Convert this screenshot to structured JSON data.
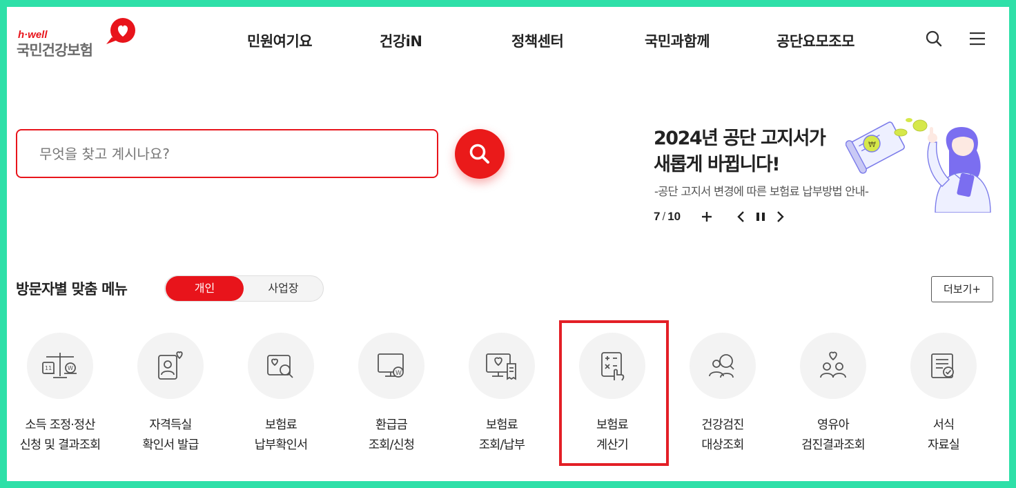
{
  "header": {
    "logo_small": "h·well",
    "logo_name": "국민건강보험",
    "nav": [
      {
        "label": "민원여기요"
      },
      {
        "label": "건강iN"
      },
      {
        "label": "정책센터"
      },
      {
        "label": "국민과함께"
      },
      {
        "label": "공단요모조모"
      }
    ],
    "icons": [
      "search-icon",
      "menu-icon"
    ]
  },
  "search": {
    "placeholder": "무엇을 찾고 계시나요?",
    "value": ""
  },
  "banner": {
    "title_line1": "2024년 공단 고지서가",
    "title_line2": "새롭게 바뀝니다!",
    "subtitle": "-공단 고지서 변경에 따른 보험료 납부방법 안내-",
    "current": "7",
    "separator": "/",
    "total": "10"
  },
  "visitor_menu": {
    "title": "방문자별 맞춤 메뉴",
    "toggle": {
      "active": "개인",
      "inactive": "사업장"
    },
    "more_label": "더보기+",
    "items": [
      {
        "line1": "소득 조정·정산",
        "line2": "신청 및 결과조회",
        "icon": "scale-calculator-icon"
      },
      {
        "line1": "자격득실",
        "line2": "확인서 발급",
        "icon": "id-card-heart-icon"
      },
      {
        "line1": "보험료",
        "line2": "납부확인서",
        "icon": "document-search-icon"
      },
      {
        "line1": "환급금",
        "line2": "조회/신청",
        "icon": "monitor-won-icon"
      },
      {
        "line1": "보험료",
        "line2": "조회/납부",
        "icon": "monitor-receipt-icon"
      },
      {
        "line1": "보험료",
        "line2": "계산기",
        "icon": "calculator-touch-icon"
      },
      {
        "line1": "건강검진",
        "line2": "대상조회",
        "icon": "people-search-icon"
      },
      {
        "line1": "영유아",
        "line2": "검진결과조회",
        "icon": "family-heart-icon"
      },
      {
        "line1": "서식",
        "line2": "자료실",
        "icon": "form-check-icon"
      }
    ]
  },
  "colors": {
    "brand_red": "#e8141b",
    "frame_green": "#2ee0a8",
    "highlight_red": "#e31f26",
    "icon_gray": "#555555"
  }
}
